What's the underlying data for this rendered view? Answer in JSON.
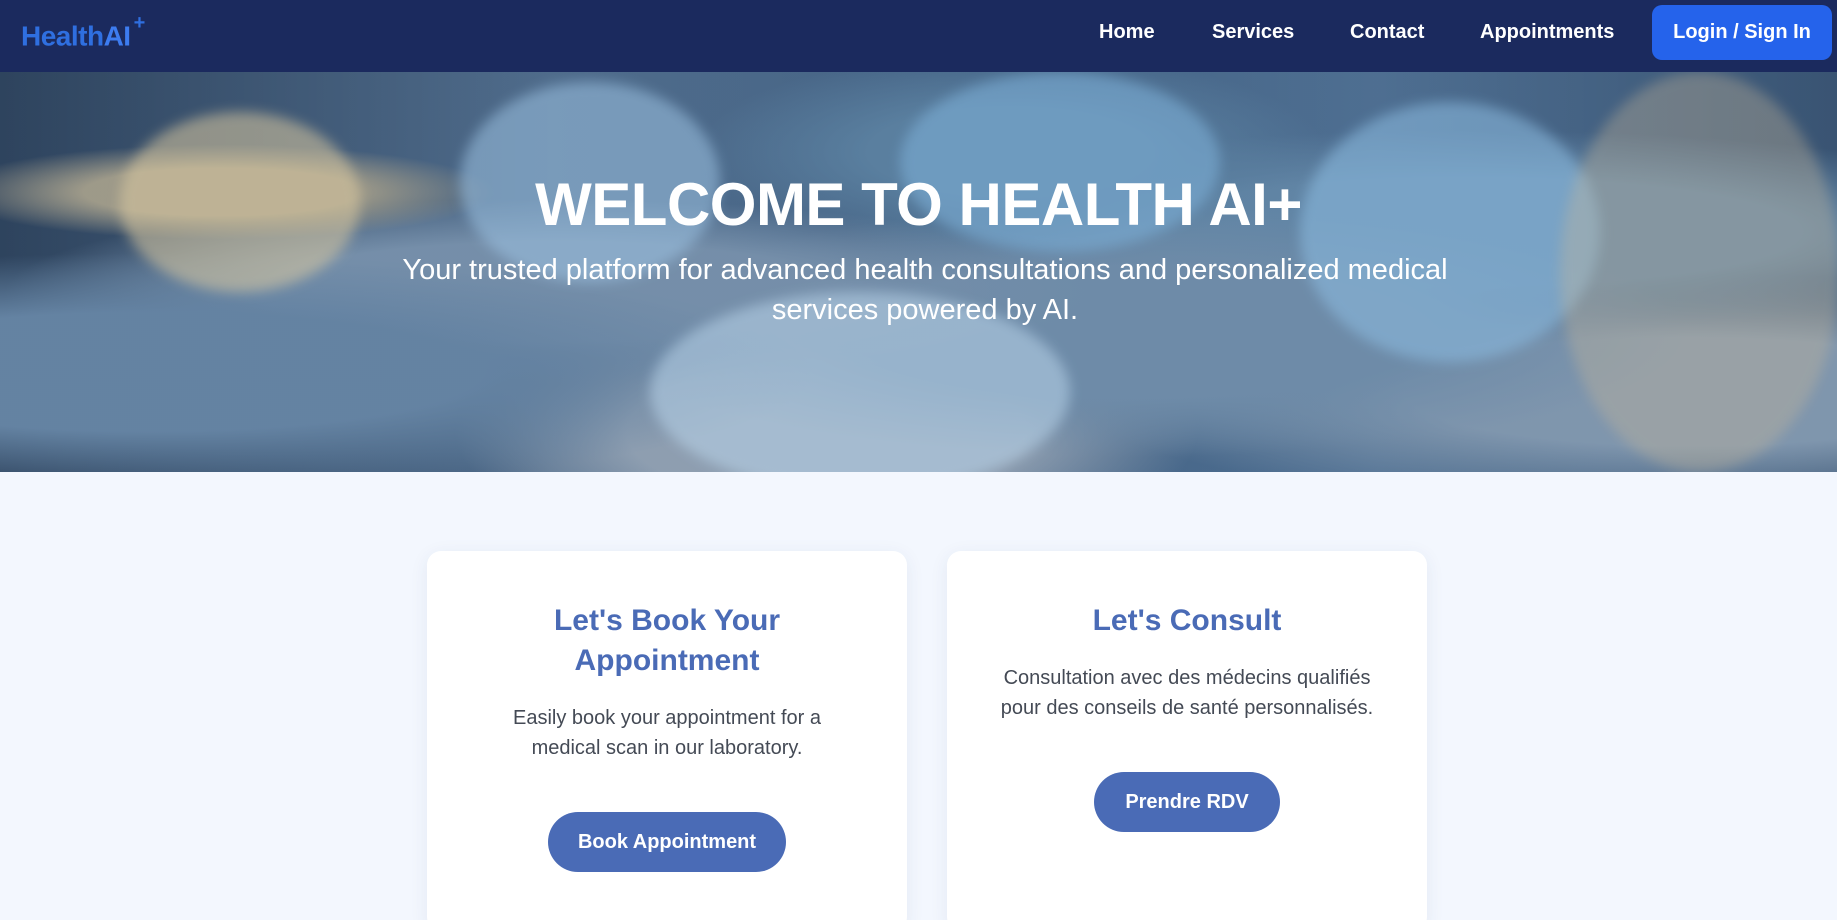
{
  "brand": {
    "name_part1": "Health",
    "name_part2": "AI",
    "name_sup": "+"
  },
  "nav": {
    "items": [
      {
        "label": "Home"
      },
      {
        "label": "Services"
      },
      {
        "label": "Contact"
      },
      {
        "label": "Appointments"
      }
    ],
    "login_label": "Login / Sign In"
  },
  "hero": {
    "title": "WELCOME TO HEALTH AI+",
    "subtitle": "Your trusted platform for advanced health consultations and personalized medical services powered by AI."
  },
  "cards": [
    {
      "title": "Let's Book Your Appointment",
      "text": "Easily book your appointment for a medical scan in our laboratory.",
      "button": "Book Appointment"
    },
    {
      "title": "Let's Consult",
      "text": "Consultation avec des médecins qualifiés pour des conseils de santé personnalisés.",
      "button": "Prendre RDV"
    }
  ],
  "colors": {
    "navbar": "#1b2a5e",
    "brand_blue": "#2f6fe0",
    "login_button": "#2563eb",
    "card_accent": "#4a6bb6",
    "page_background": "#f3f7fe"
  }
}
